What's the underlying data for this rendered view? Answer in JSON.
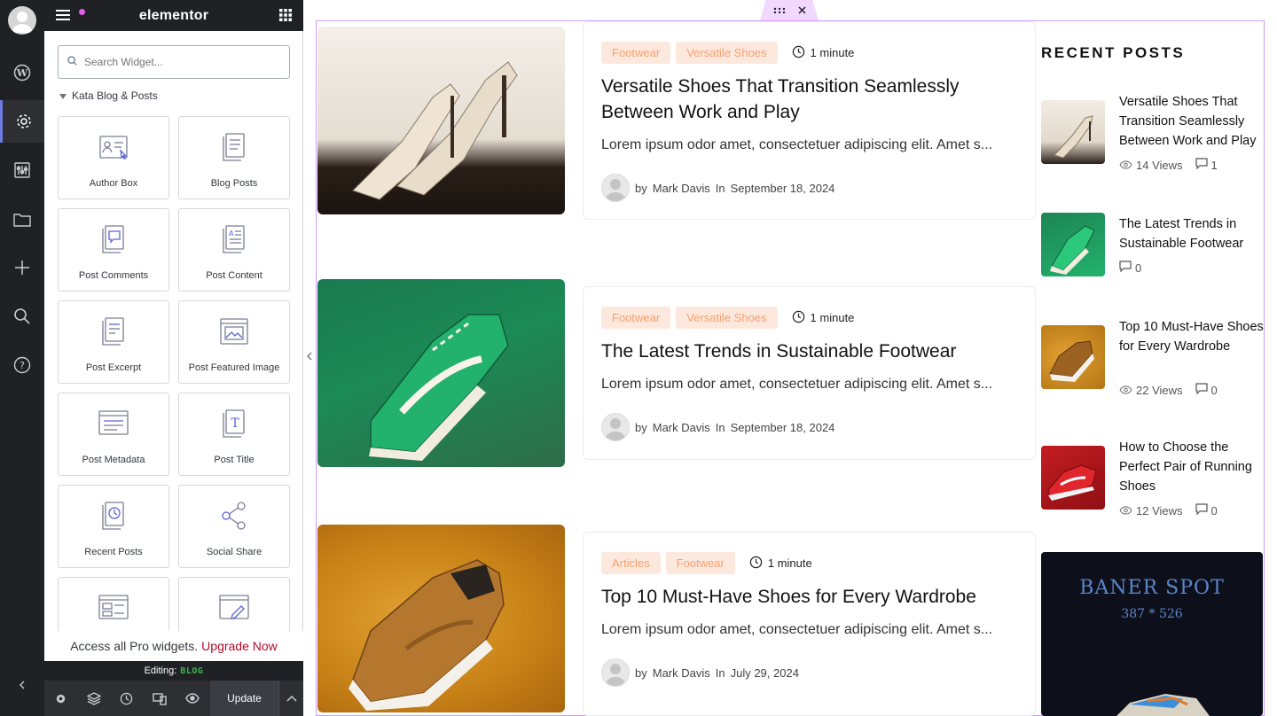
{
  "panel": {
    "logo": "elementor",
    "search_placeholder": "Search Widget...",
    "category": "Kata Blog & Posts",
    "widgets": [
      {
        "label": "Author Box"
      },
      {
        "label": "Blog Posts"
      },
      {
        "label": "Post Comments"
      },
      {
        "label": "Post Content"
      },
      {
        "label": "Post Excerpt"
      },
      {
        "label": "Post Featured Image"
      },
      {
        "label": "Post Metadata"
      },
      {
        "label": "Post Title"
      },
      {
        "label": "Recent Posts"
      },
      {
        "label": "Social Share"
      },
      {
        "label": ""
      },
      {
        "label": ""
      }
    ],
    "promo_text": "Access all Pro widgets.",
    "promo_link": "Upgrade Now",
    "editing_label": "Editing:",
    "editing_value": "BLOG",
    "update_label": "Update"
  },
  "posts": [
    {
      "tags": [
        "Footwear",
        "Versatile Shoes"
      ],
      "time": "1 minute",
      "title": "Versatile Shoes That Transition Seamlessly Between Work and Play",
      "excerpt": "Lorem ipsum odor amet, consectetuer adipiscing elit. Amet s...",
      "by": "by",
      "author": "Mark Davis",
      "in": "In",
      "date": "September 18, 2024",
      "image_color": "#e9e4dc"
    },
    {
      "tags": [
        "Footwear",
        "Versatile Shoes"
      ],
      "time": "1 minute",
      "title": "The Latest Trends in Sustainable Footwear",
      "excerpt": "Lorem ipsum odor amet, consectetuer adipiscing elit. Amet s...",
      "by": "by",
      "author": "Mark Davis",
      "in": "In",
      "date": "September 18, 2024",
      "image_color": "#1f8c5a"
    },
    {
      "tags": [
        "Articles",
        "Footwear"
      ],
      "time": "1 minute",
      "title": "Top 10 Must-Have Shoes for Every Wardrobe",
      "excerpt": "Lorem ipsum odor amet, consectetuer adipiscing elit. Amet s...",
      "by": "by",
      "author": "Mark Davis",
      "in": "In",
      "date": "July 29, 2024",
      "image_color": "#d99422"
    }
  ],
  "sidebar": {
    "title": "RECENT POSTS",
    "items": [
      {
        "title": "Versatile Shoes That Transition Seamlessly Between Work and Play",
        "views": "14 Views",
        "comments": "1"
      },
      {
        "title": "The Latest Trends in Sustainable Footwear",
        "views": "",
        "comments": "0"
      },
      {
        "title": "Top 10 Must-Have Shoes for Every Wardrobe",
        "views": "22 Views",
        "comments": "0"
      },
      {
        "title": "How to Choose the Perfect Pair of Running Shoes",
        "views": "12 Views",
        "comments": "0"
      }
    ],
    "banner_title": "BANER SPOT",
    "banner_size": "387 * 526"
  },
  "colors": {
    "accent": "#d19bf5",
    "tag_bg": "#fde8de",
    "tag_text": "#f7a16e",
    "upgrade": "#b5092a",
    "editing_value": "#39b54a"
  }
}
